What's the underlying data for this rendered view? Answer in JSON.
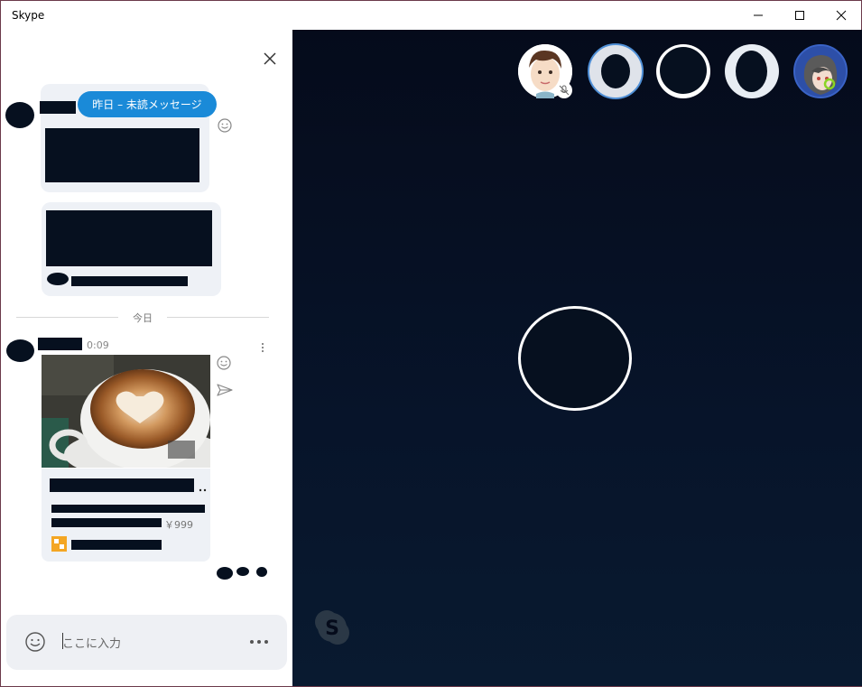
{
  "window": {
    "title": "Skype"
  },
  "chat": {
    "unread_label": "昨日 – 未読メッセージ",
    "divider_today": "今日",
    "message_time": "0:09",
    "price": "￥999",
    "composer_placeholder": "ここに入力"
  },
  "colors": {
    "accent": "#1a8ad8",
    "call_bg": "#050b1b"
  },
  "icons": [
    "close-icon",
    "emoji-icon",
    "send-icon",
    "more-icon",
    "minimize-icon",
    "maximize-icon",
    "mic-muted-icon",
    "skype-logo-icon"
  ]
}
